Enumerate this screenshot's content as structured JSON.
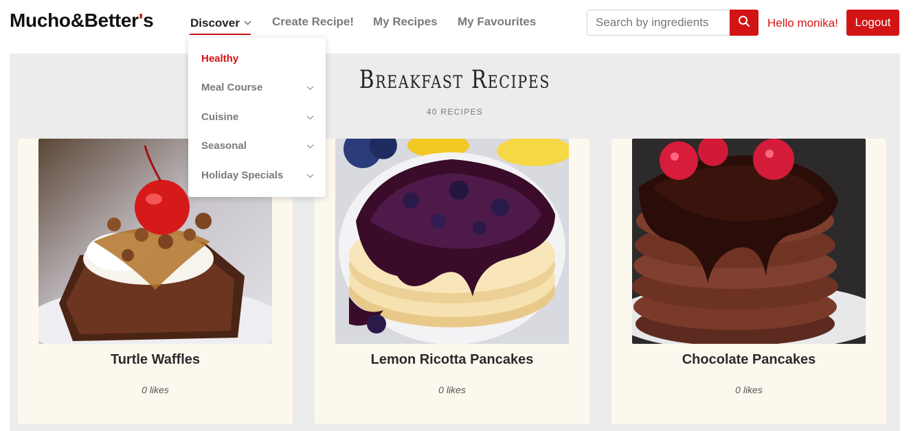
{
  "brand": {
    "name_main": "Mucho&Better",
    "name_apostrophe": "'",
    "name_suffix": "s",
    "accent_color": "#d21414"
  },
  "nav": {
    "discover": "Discover",
    "create": "Create Recipe!",
    "my_recipes": "My Recipes",
    "favourites": "My Favourites"
  },
  "search": {
    "placeholder": "Search by ingredients",
    "value": "",
    "icon": "search-icon"
  },
  "user": {
    "greeting": "Hello monika!",
    "logout_label": "Logout"
  },
  "dropdown": {
    "items": [
      {
        "label": "Healthy",
        "has_submenu": false,
        "active": true
      },
      {
        "label": "Meal Course",
        "has_submenu": true,
        "active": false
      },
      {
        "label": "Cuisine",
        "has_submenu": true,
        "active": false
      },
      {
        "label": "Seasonal",
        "has_submenu": true,
        "active": false
      },
      {
        "label": "Holiday Specials",
        "has_submenu": true,
        "active": false
      }
    ]
  },
  "page": {
    "title": "Breakfast Recipes",
    "count": "40 RECIPES"
  },
  "recipes": [
    {
      "title": "Turtle Waffles",
      "likes": "0 likes"
    },
    {
      "title": "Lemon Ricotta Pancakes",
      "likes": "0 likes"
    },
    {
      "title": "Chocolate Pancakes",
      "likes": "0 likes"
    }
  ]
}
